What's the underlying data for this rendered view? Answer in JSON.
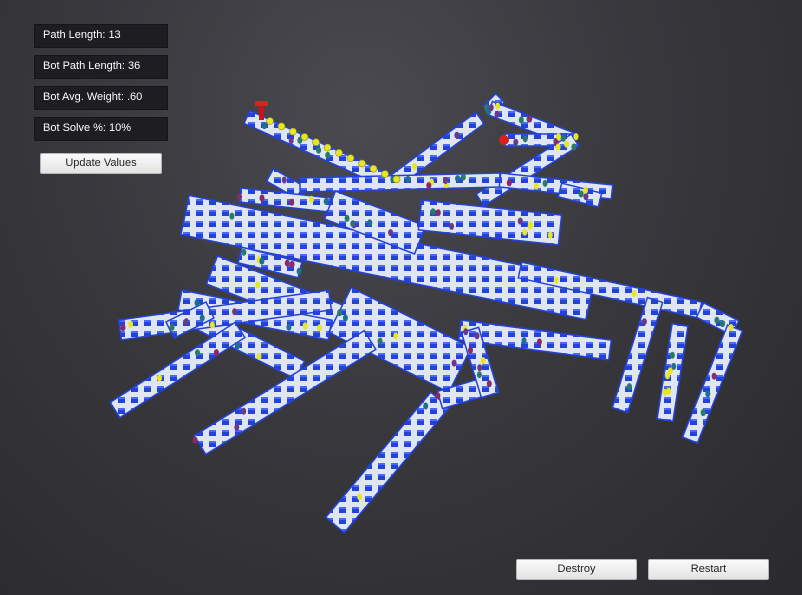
{
  "hud": {
    "path_length": "Path Length: 13",
    "bot_path_length": "Bot Path Length: 36",
    "bot_avg_weight": "Bot Avg. Weight: .60",
    "bot_solve_pct": "Bot Solve %: 10%",
    "update_button": "Update Values"
  },
  "controls": {
    "destroy_button": "Destroy",
    "restart_button": "Restart"
  },
  "scene": {
    "floor_color": "#dfe6f0",
    "wall_color": "#2442d8",
    "start_marker_color": "#e02020",
    "bot_marker_color": "#e02020",
    "path_marker_color": "#e6e622",
    "weight_marker_colors": [
      "#2a7a6a",
      "#8a2a6a",
      "#e6e622",
      "#1f6f8f",
      "#6a3a8a"
    ]
  }
}
